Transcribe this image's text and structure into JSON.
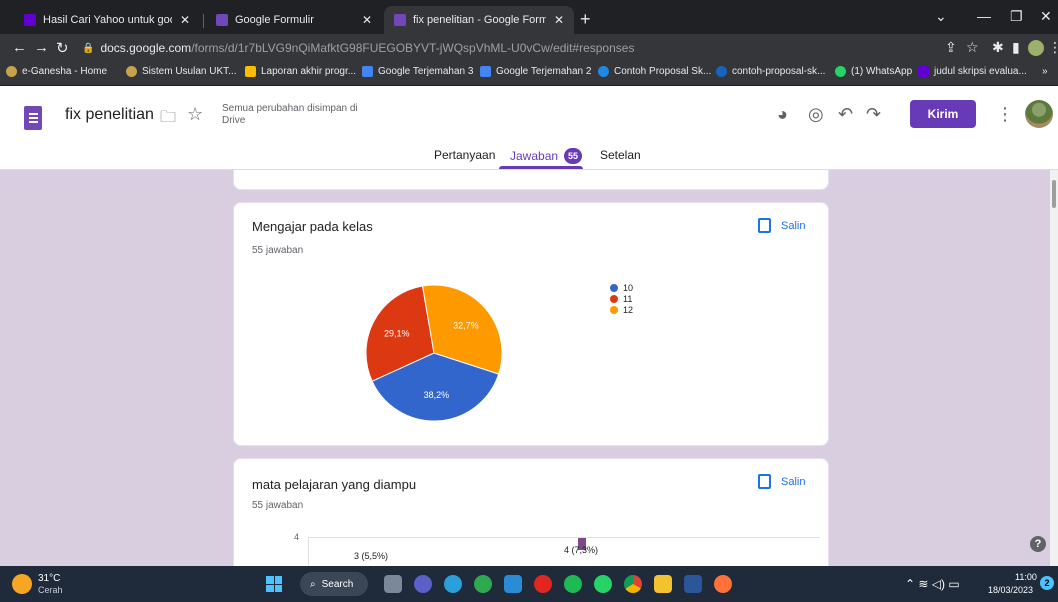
{
  "browser": {
    "tabs": [
      {
        "label": "Hasil Cari Yahoo untuk google fo",
        "active": false
      },
      {
        "label": "Google Formulir",
        "active": false
      },
      {
        "label": "fix penelitian - Google Formulir",
        "active": true
      }
    ],
    "url_host": "docs.google.com",
    "url_path": "/forms/d/1r7bLVG9nQiMafktG98FUEGOBYVT-jWQspVhML-U0vCw/edit#responses",
    "bookmarks": [
      "e-Ganesha - Home",
      "Sistem Usulan UKT...",
      "Laporan akhir progr...",
      "Google Terjemahan 3",
      "Google Terjemahan 2",
      "Contoh Proposal Sk...",
      "contoh-proposal-sk...",
      "(1) WhatsApp",
      "judul skripsi evalua..."
    ]
  },
  "form_header": {
    "title": "fix penelitian",
    "save_status": "Semua perubahan disimpan di Drive",
    "send_label": "Kirim",
    "tabs": [
      {
        "label": "Pertanyaan"
      },
      {
        "label": "Jawaban",
        "badge": "55"
      },
      {
        "label": "Setelan"
      }
    ]
  },
  "cards": [
    {
      "title": "Mengajar pada kelas",
      "subtitle": "55 jawaban",
      "copy_label": "Salin"
    },
    {
      "title": "mata pelajaran yang diampu",
      "subtitle": "55 jawaban",
      "copy_label": "Salin",
      "partial_labels": {
        "y_tick": "4",
        "bar_label": "4 (7,3%)",
        "left_label": "3 (5,5%)"
      }
    }
  ],
  "chart_data": {
    "type": "pie",
    "title": "Mengajar pada kelas",
    "categories": [
      "10",
      "11",
      "12"
    ],
    "values": [
      38.2,
      29.1,
      32.7
    ],
    "labels": [
      "38,2%",
      "29,1%",
      "32,7%"
    ],
    "colors": [
      "#3366cc",
      "#dc3912",
      "#ff9900"
    ],
    "legend_position": "right"
  },
  "taskbar": {
    "temp": "31°C",
    "condition": "Cerah",
    "search_label": "Search",
    "time": "11:00",
    "date": "18/03/2023",
    "notifications": "2"
  }
}
